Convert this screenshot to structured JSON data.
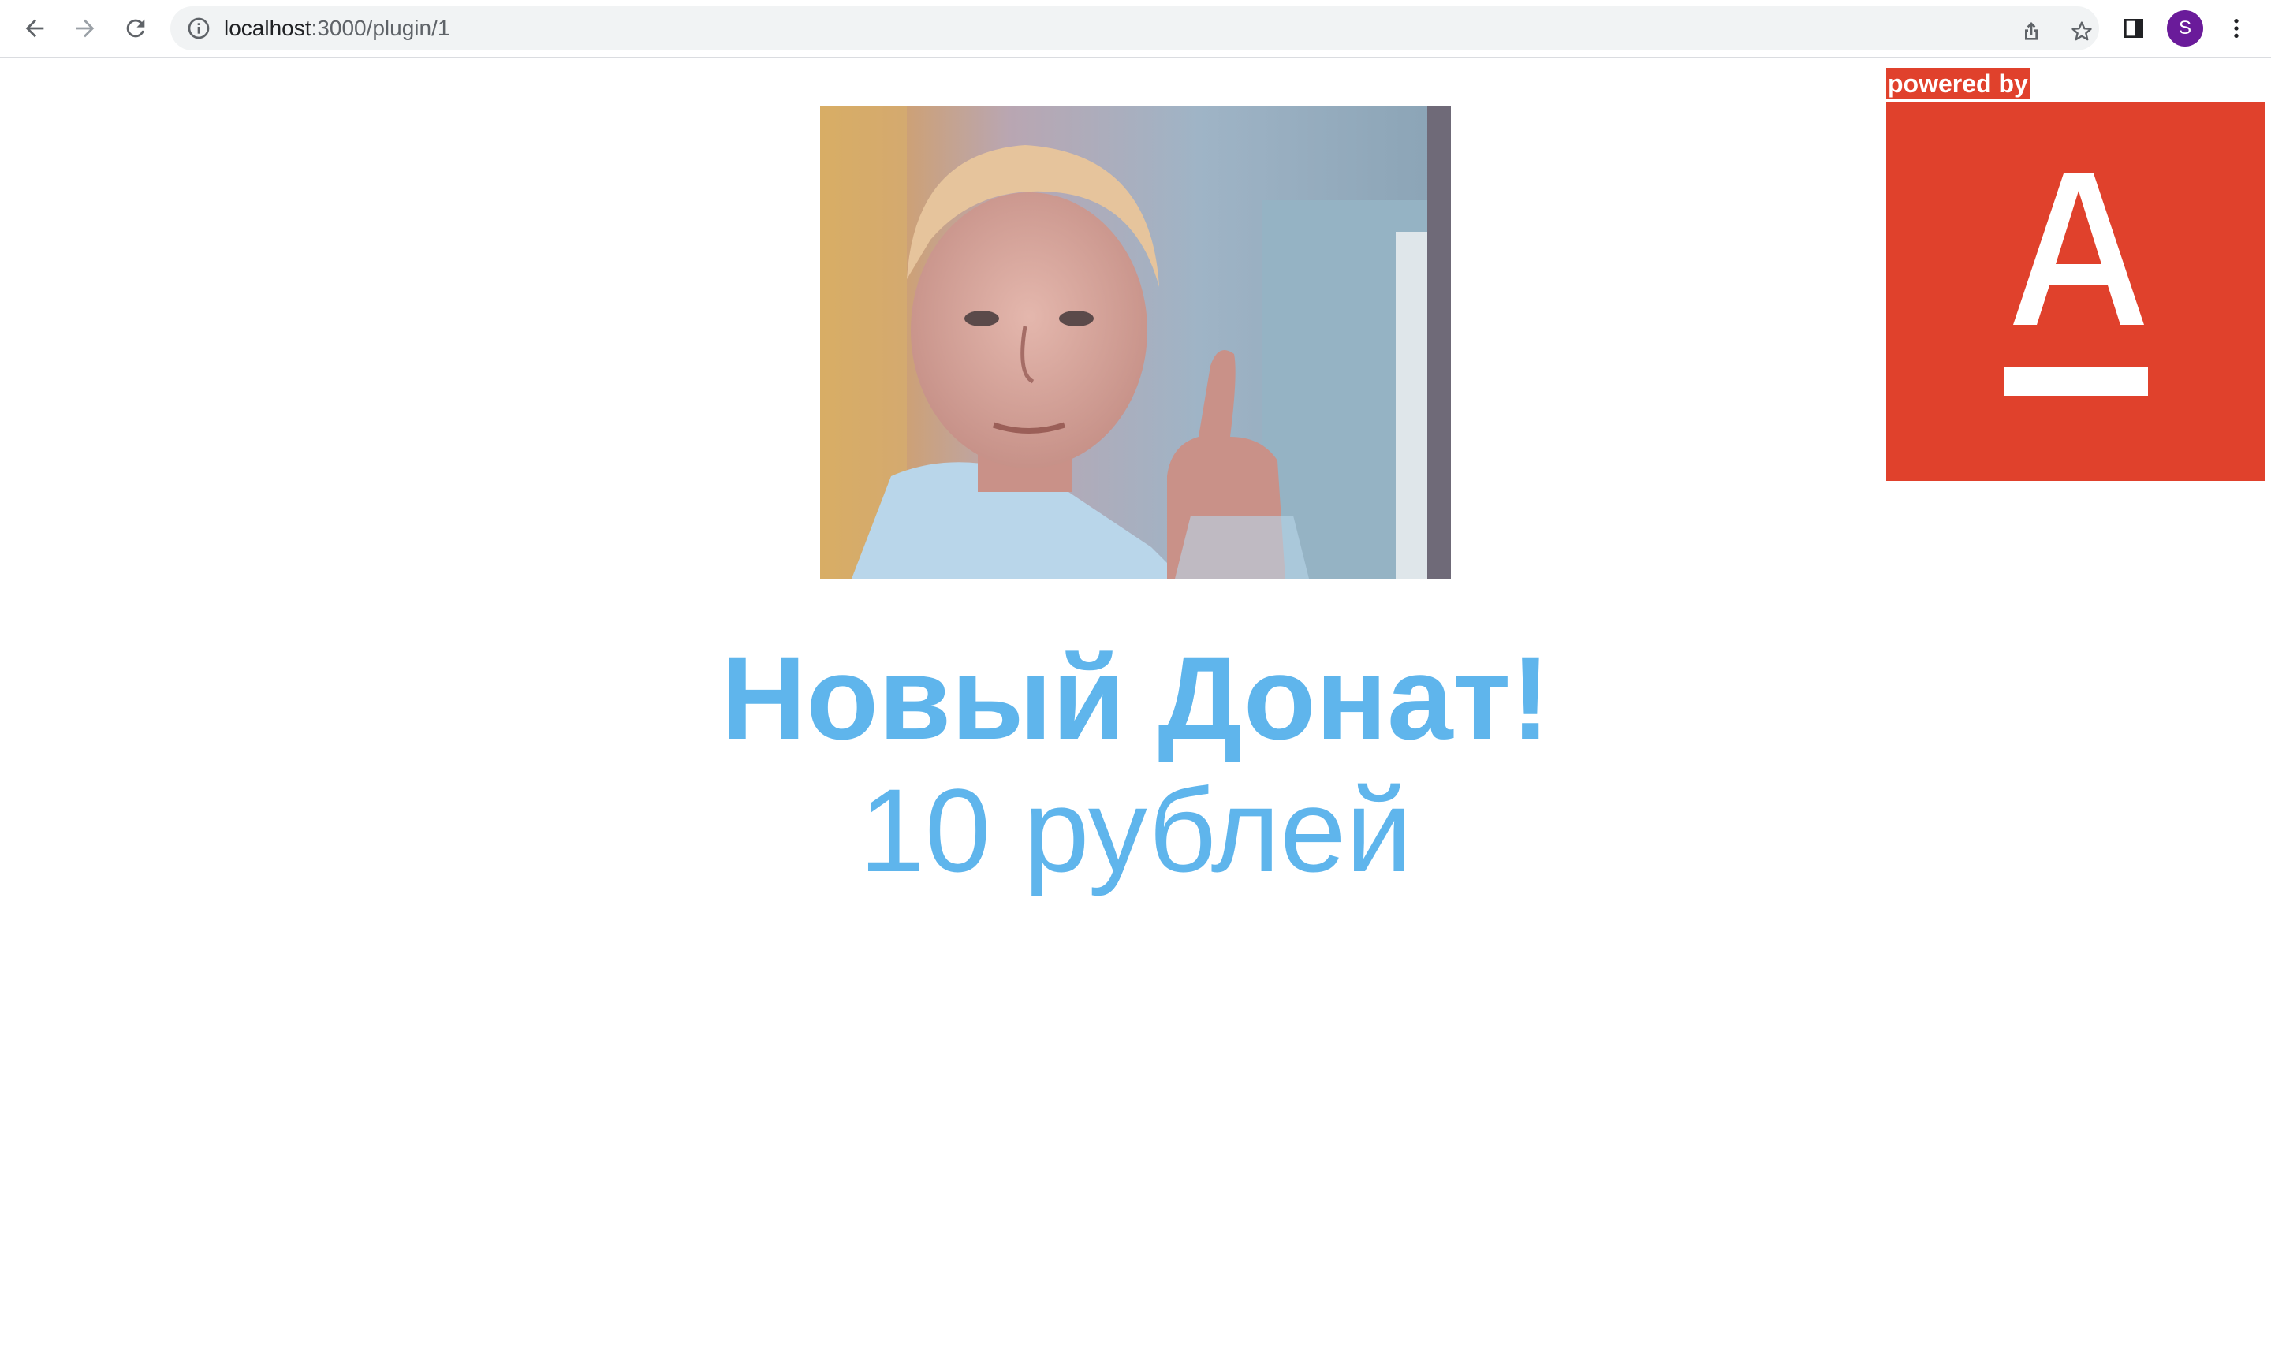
{
  "browser": {
    "url_host": "localhost",
    "url_path": ":3000/plugin/1",
    "profile_initial": "S",
    "avatar_color": "#6a1b9a"
  },
  "page": {
    "image_alt_icon": "thumbs-up-boy-gif",
    "title": "Новый Донат!",
    "amount": "10 рублей",
    "text_color": "#5fb5ec"
  },
  "sponsor": {
    "powered_label": "powered by",
    "brand_color": "#e0412c",
    "logo_icon": "alfa-bank-logo"
  }
}
